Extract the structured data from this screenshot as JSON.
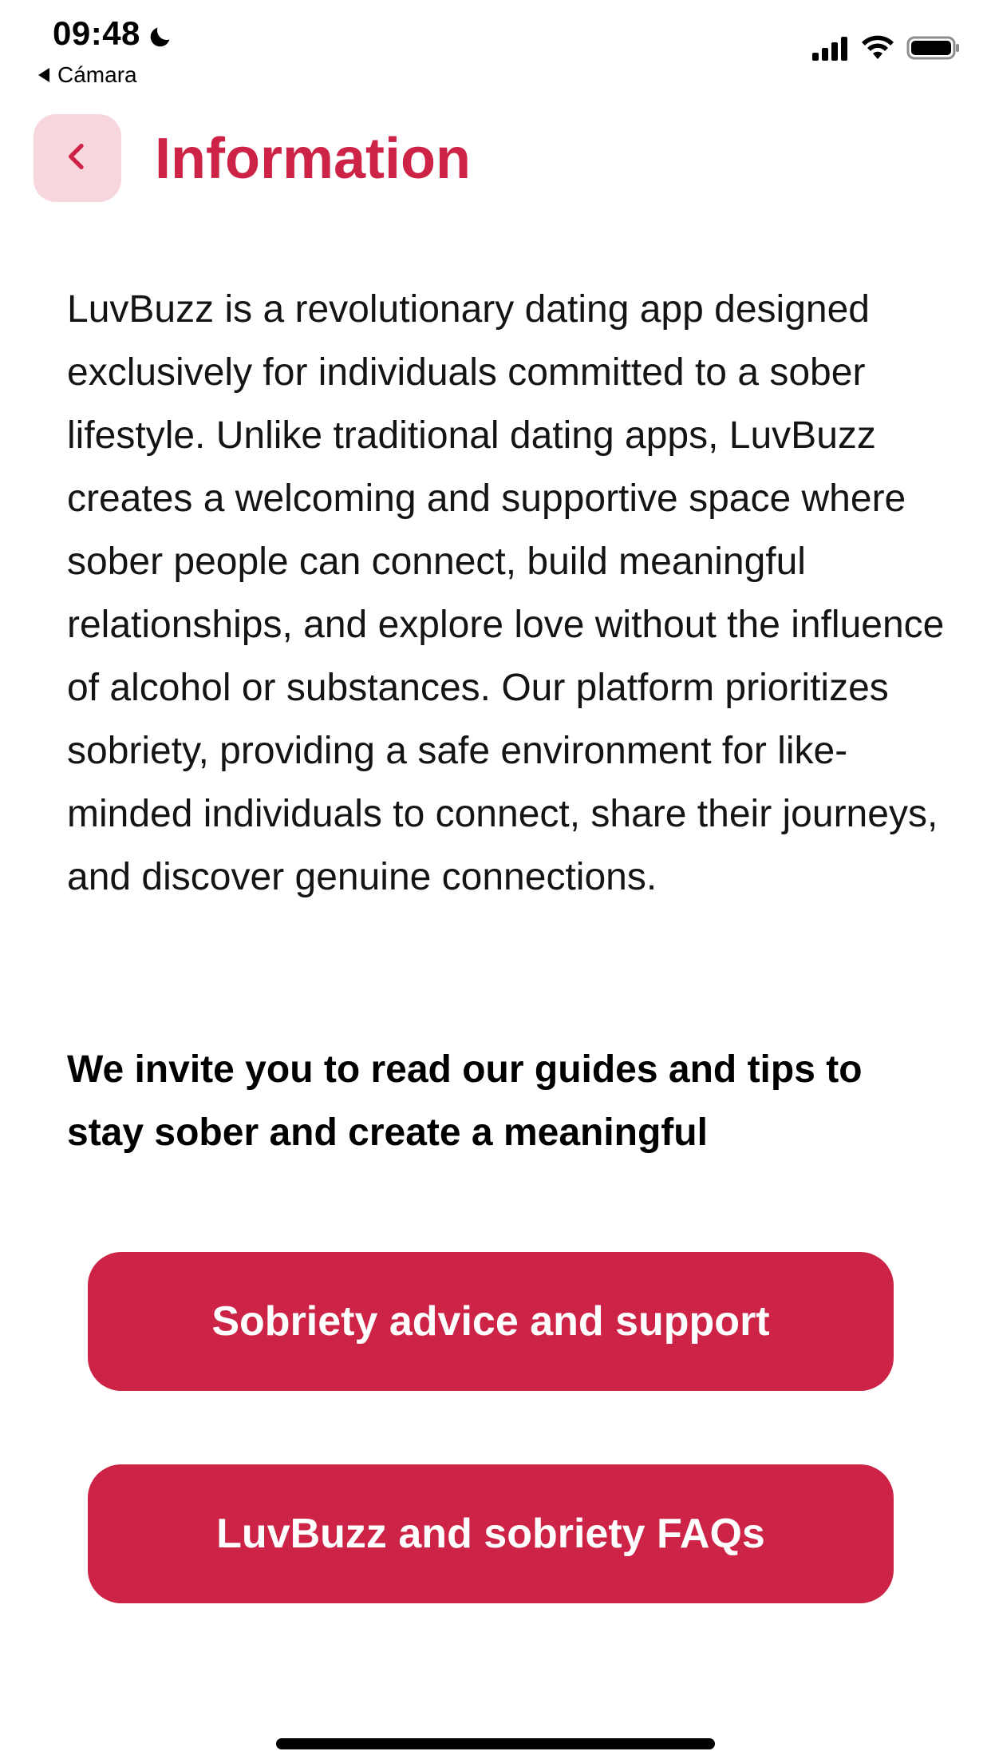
{
  "status_bar": {
    "time": "09:48",
    "back_app_label": "Cámara",
    "icons": [
      "moon-icon",
      "signal-icon",
      "wifi-icon",
      "battery-icon"
    ]
  },
  "header": {
    "back_icon": "chevron-left-icon",
    "title": "Information"
  },
  "content": {
    "intro": "LuvBuzz is a revolutionary dating app designed exclusively for individuals committed to a sober lifestyle. Unlike traditional dating apps, LuvBuzz creates a welcoming and supportive space where sober people can connect, build meaningful relationships, and explore love without the influence of alcohol or substances. Our platform prioritizes sobriety, providing a safe environment for like-minded individuals to connect, share their journeys, and discover genuine connections.",
    "invite": "We invite you to read our guides and tips to stay sober and create a meaningful"
  },
  "buttons": {
    "sobriety_advice": "Sobriety advice and support",
    "faqs": "LuvBuzz and sobriety FAQs"
  },
  "colors": {
    "accent": "#cc2346",
    "back_button_bg": "#f7d7dd",
    "text": "#141414"
  }
}
